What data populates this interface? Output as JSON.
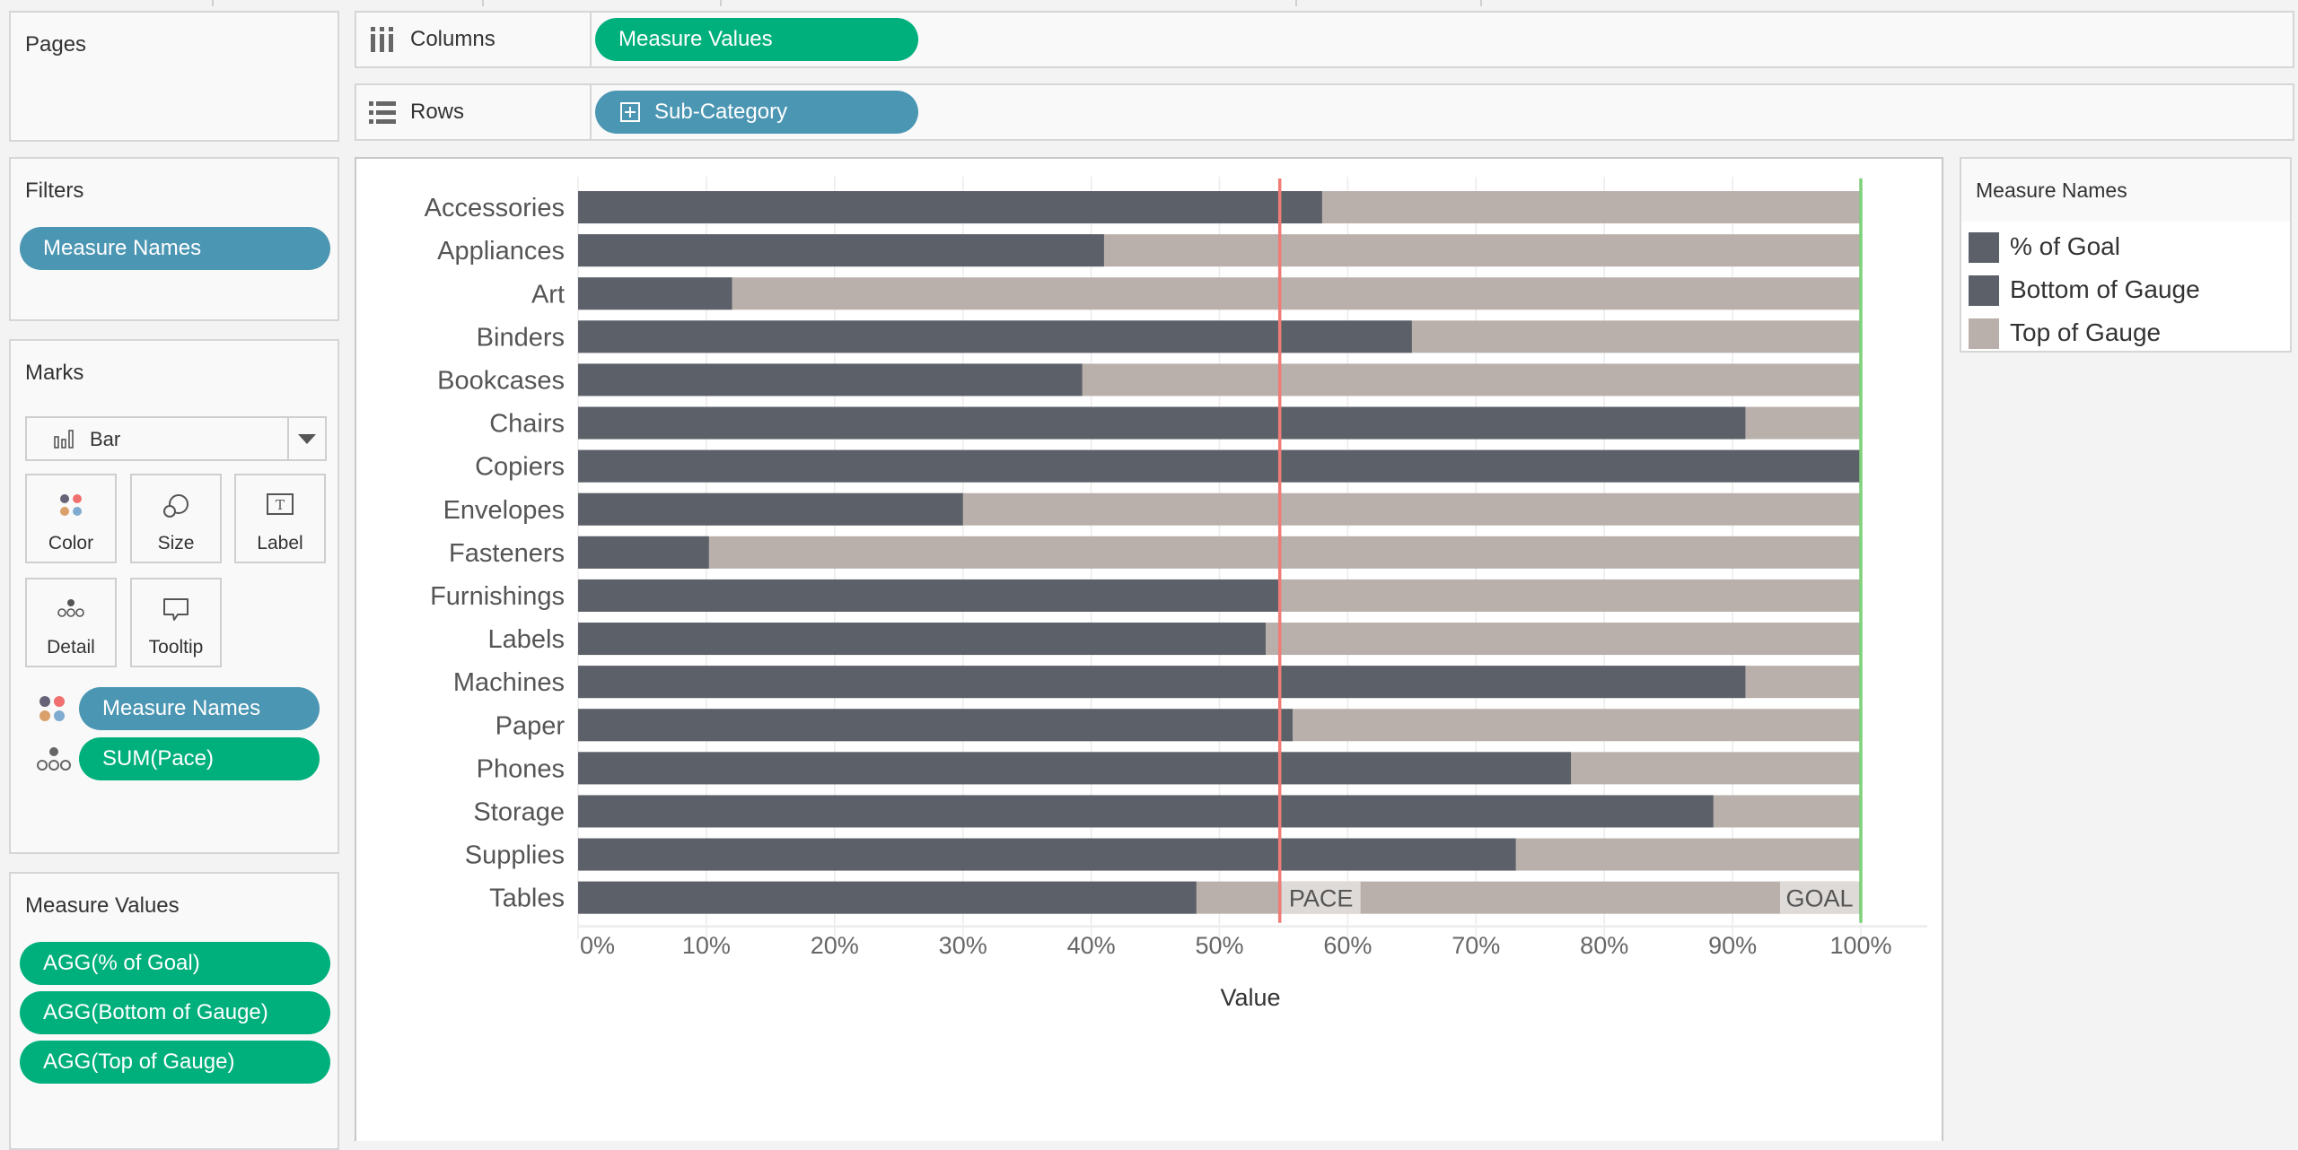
{
  "pages": {
    "title": "Pages"
  },
  "columns_shelf": {
    "label": "Columns",
    "icon": "columns-icon",
    "pill": {
      "label": "Measure Values",
      "color": "#00b07c"
    }
  },
  "rows_shelf": {
    "label": "Rows",
    "icon": "rows-icon",
    "pill": {
      "label": "Sub-Category",
      "icon": "expand-plus-icon",
      "color": "#4b96b3"
    }
  },
  "filters": {
    "title": "Filters",
    "pills": [
      {
        "label": "Measure Names",
        "color": "#4b96b3"
      }
    ]
  },
  "marks": {
    "title": "Marks",
    "mark_type": "Bar",
    "buttons": [
      {
        "label": "Color",
        "icon": "color-icon"
      },
      {
        "label": "Size",
        "icon": "size-icon"
      },
      {
        "label": "Label",
        "icon": "label-icon"
      },
      {
        "label": "Detail",
        "icon": "detail-icon"
      },
      {
        "label": "Tooltip",
        "icon": "tooltip-icon"
      }
    ],
    "fields": [
      {
        "label": "Measure Names",
        "icon": "color-icon",
        "color": "#4b96b3"
      },
      {
        "label": "SUM(Pace)",
        "icon": "detail-icon",
        "color": "#00b07c"
      }
    ]
  },
  "measure_values": {
    "title": "Measure Values",
    "pills": [
      {
        "label": "AGG(% of Goal)"
      },
      {
        "label": "AGG(Bottom of Gauge)"
      },
      {
        "label": "AGG(Top of Gauge)"
      }
    ]
  },
  "legend": {
    "title": "Measure Names",
    "items": [
      {
        "label": "% of Goal",
        "color": "#5c6069"
      },
      {
        "label": "Bottom of Gauge",
        "color": "#5c6069"
      },
      {
        "label": "Top of Gauge",
        "color": "#b9b0ab"
      }
    ]
  },
  "chart_data": {
    "type": "bar",
    "orientation": "horizontal",
    "title": "",
    "xlabel": "Value",
    "ylabel": "",
    "xlim": [
      0,
      1
    ],
    "x_ticks": [
      "0%",
      "10%",
      "20%",
      "30%",
      "40%",
      "50%",
      "60%",
      "70%",
      "80%",
      "90%",
      "100%"
    ],
    "grid": true,
    "categories": [
      "Accessories",
      "Appliances",
      "Art",
      "Binders",
      "Bookcases",
      "Chairs",
      "Copiers",
      "Envelopes",
      "Fasteners",
      "Furnishings",
      "Labels",
      "Machines",
      "Paper",
      "Phones",
      "Storage",
      "Supplies",
      "Tables"
    ],
    "series": [
      {
        "name": "% of Goal",
        "color": "#5c6069",
        "values": [
          0.58,
          0.41,
          0.12,
          0.65,
          0.393,
          0.91,
          1.0,
          0.3,
          0.102,
          0.547,
          0.536,
          0.91,
          0.557,
          0.774,
          0.885,
          0.731,
          0.482
        ]
      },
      {
        "name": "Top of Gauge",
        "color": "#b9b0ab",
        "values": [
          1,
          1,
          1,
          1,
          1,
          1,
          1,
          1,
          1,
          1,
          1,
          1,
          1,
          1,
          1,
          1,
          1
        ]
      }
    ],
    "reference_lines": [
      {
        "name": "Pace",
        "value": 0.547,
        "color": "#f07c78",
        "label": "PACE"
      },
      {
        "name": "Goal",
        "value": 1.0,
        "color": "#7fd17a",
        "label": "GOAL"
      }
    ]
  }
}
